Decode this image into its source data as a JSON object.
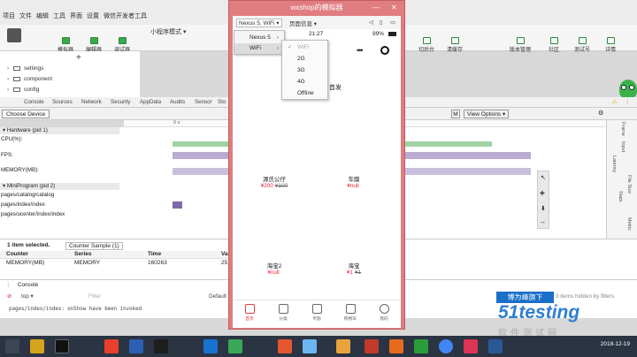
{
  "menubar": {
    "items": [
      "项目",
      "文件",
      "编辑",
      "工具",
      "界面",
      "设置",
      "微信开发者工具"
    ]
  },
  "toolbar": {
    "left": [
      "模拟器",
      "编辑器",
      "调试器"
    ],
    "mode": "小程序模式",
    "right": [
      "切后台",
      "清缓存",
      "版本管理",
      "社区",
      "测试号",
      "详情"
    ]
  },
  "tree": {
    "items": [
      "settings",
      "component",
      "config"
    ]
  },
  "devtools": {
    "tabs": [
      "Console",
      "Sources",
      "Network",
      "Security",
      "AppData",
      "Audits",
      "Sensor",
      "Sto"
    ],
    "choose": "Choose Device",
    "view_options": "View Options",
    "m_label": "M",
    "ruler_mark": "0 s",
    "sections": {
      "hardware": "Hardware (pid 1)",
      "cpu": "CPU(%):",
      "fps": "FPS:",
      "memory": "MEMORY(MB):",
      "mini": "MiniProgram (pid 2)",
      "p1": "pages/catalog/catalog",
      "p2": "pages/index/index",
      "p3": "pages/ucenter/index/index"
    },
    "right_vertical": [
      "Frame",
      "Input",
      "Latency",
      "File Size",
      "Stats",
      "Metric"
    ]
  },
  "bottom": {
    "selected": "1 item selected.",
    "tab": "Counter Sample (1)",
    "headers": [
      "Counter",
      "Series",
      "Time",
      "Va"
    ],
    "row": [
      "MEMORY(MB)",
      "MEMORY",
      "160263",
      "25"
    ]
  },
  "console": {
    "tab": "Console",
    "context": "top",
    "filter_placeholder": "Filter",
    "level": "Default",
    "hidden": "3 items hidden by filters",
    "log": "pages/index/index: onShow have been invoked"
  },
  "simulator": {
    "title": "wxshop的模拟器",
    "device": "Nexus 5, WiFi",
    "page_info": "页面信息",
    "time": "21:27",
    "battery": "99%",
    "promo": "首发",
    "products": [
      {
        "name": "源氏公仔",
        "price": "¥200",
        "old": "¥100"
      },
      {
        "name": "车膜",
        "price": "¥null",
        "old": ""
      },
      {
        "name": "海宝2",
        "price": "¥null",
        "old": ""
      },
      {
        "name": "海宝",
        "price": "¥1",
        "old": "¥1"
      }
    ],
    "tabs": [
      "首页",
      "分类",
      "专题",
      "购物车",
      "我的"
    ]
  },
  "menu1": {
    "items": [
      "Nexus 5",
      "WiFi"
    ]
  },
  "menu2": {
    "items": [
      "WiFi",
      "2G",
      "3G",
      "4G",
      "Offline"
    ],
    "checked": "WiFi"
  },
  "watermark": {
    "line1": "博为峰旗下",
    "brand": "51testing",
    "line3": "软件测试网"
  },
  "taskbar": {
    "time": "",
    "date": "2018-12-19"
  },
  "colors": {
    "sim_frame": "#e07d80",
    "accent_green": "#39a94e",
    "price_red": "#e22233",
    "taskbar": "#2b3442"
  }
}
